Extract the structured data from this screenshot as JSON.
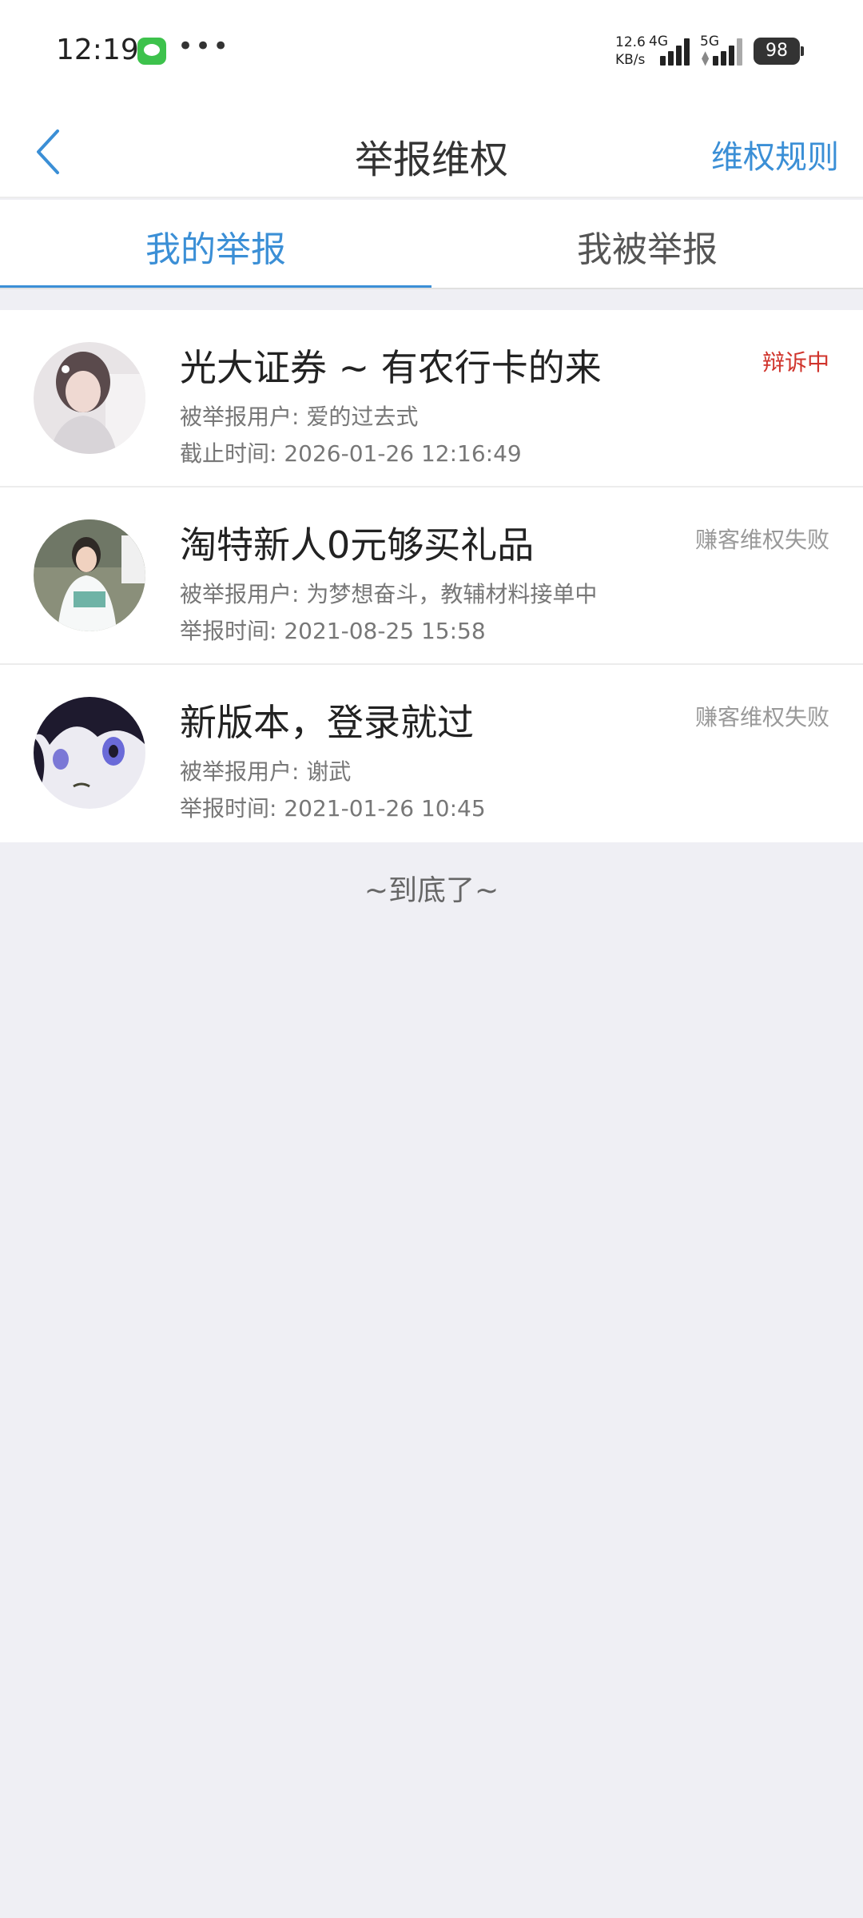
{
  "status_bar": {
    "time": "12:19",
    "network_speed_value": "12.6",
    "network_speed_unit": "KB/s",
    "net_4g": "4G",
    "net_5g": "5G",
    "battery": "98",
    "more_dots": "•••"
  },
  "navbar": {
    "title": "举报维权",
    "rules_link": "维权规则"
  },
  "tabs": {
    "my_reports": "我的举报",
    "reported_me": "我被举报"
  },
  "items": [
    {
      "title": "光大证券 ~ 有农行卡的来",
      "user_label": "被举报用户:",
      "user": "爱的过去式",
      "time_label": "截止时间:",
      "time": "2026-01-26 12:16:49",
      "status": "辩诉中",
      "status_color": "#d0342c"
    },
    {
      "title": "淘特新人0元够买礼品",
      "user_label": "被举报用户:",
      "user": "为梦想奋斗，教辅材料接单中",
      "time_label": "举报时间:",
      "time": "2021-08-25 15:58",
      "status": "赚客维权失败",
      "status_color": "#999999"
    },
    {
      "title": "新版本，登录就过",
      "user_label": "被举报用户:",
      "user": "谢武",
      "time_label": "举报时间:",
      "time": "2021-01-26 10:45",
      "status": "赚客维权失败",
      "status_color": "#999999"
    }
  ],
  "footer": {
    "end_text": "~到底了~"
  },
  "colors": {
    "accent": "#3b8fd6",
    "background": "#efeff4",
    "status_active": "#d0342c"
  }
}
